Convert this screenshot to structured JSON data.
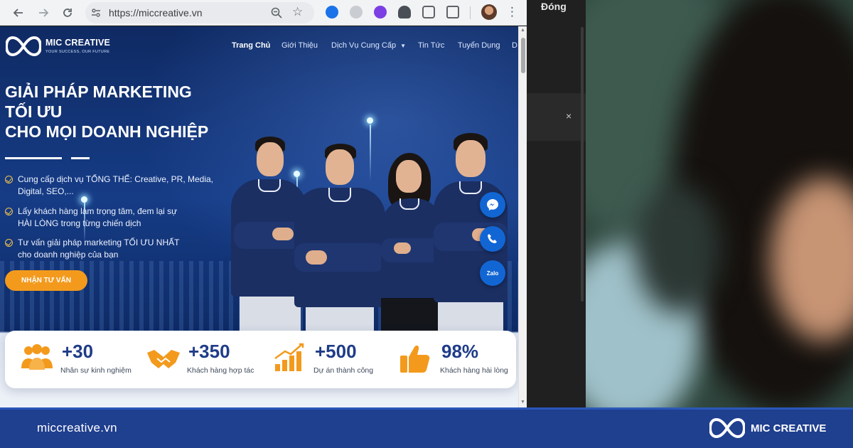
{
  "browser": {
    "url": "https://miccreative.vn",
    "icons": [
      "back-icon",
      "forward-icon",
      "reload-icon",
      "site-settings-icon",
      "zoom-icon",
      "bookmark-star-icon",
      "extensions-icon",
      "menu-icon"
    ]
  },
  "site": {
    "logo": {
      "title": "MIC CREATIVE",
      "tagline": "YOUR SUCCESS, OUR FUTURE"
    },
    "nav": [
      {
        "label": "Trang Chủ",
        "active": true
      },
      {
        "label": "Giới Thiệu"
      },
      {
        "label": "Dịch Vụ Cung Cấp",
        "dropdown": true
      },
      {
        "label": "Tin Tức"
      },
      {
        "label": "Tuyển Dụng"
      },
      {
        "label": "D"
      }
    ],
    "hero": {
      "title_lines": [
        "GIẢI PHÁP MARKETING",
        "TỐI ƯU",
        "CHO MỌI DOANH NGHIỆP"
      ],
      "bullets": [
        {
          "line1": "Cung cấp dịch vụ TỔNG THỂ: Creative, PR, Media,",
          "line2": "Digital, SEO,..."
        },
        {
          "line1": "Lấy khách hàng làm trọng tâm, đem lại sự",
          "line2": "HÀI LÒNG trong từng chiến dịch"
        },
        {
          "line1": "Tư vấn giải pháp marketing TỐI ƯU NHẤT",
          "line2": "cho doanh nghiệp của bạn"
        }
      ],
      "cta": "NHẬN TƯ VẤN"
    },
    "fab": {
      "zalo": "Zalo"
    },
    "stats": [
      {
        "value": "+30",
        "label": "Nhân sự kinh nghiệm",
        "icon": "team-icon"
      },
      {
        "value": "+350",
        "label": "Khách hàng hợp tác",
        "icon": "handshake-icon"
      },
      {
        "value": "+500",
        "label": "Dự án thành công",
        "icon": "growth-chart-icon"
      },
      {
        "value": "98%",
        "label": "Khách hàng hài lòng",
        "icon": "thumbs-up-icon"
      }
    ],
    "colors": {
      "primary": "#1f3c88",
      "accent": "#f39a1d",
      "hero_bg": "#163c86"
    }
  },
  "side_panel": {
    "close_label": "Đóng",
    "close_icon": "×"
  },
  "banner": {
    "url": "miccreative.vn",
    "brand": "MIC CREATIVE"
  }
}
